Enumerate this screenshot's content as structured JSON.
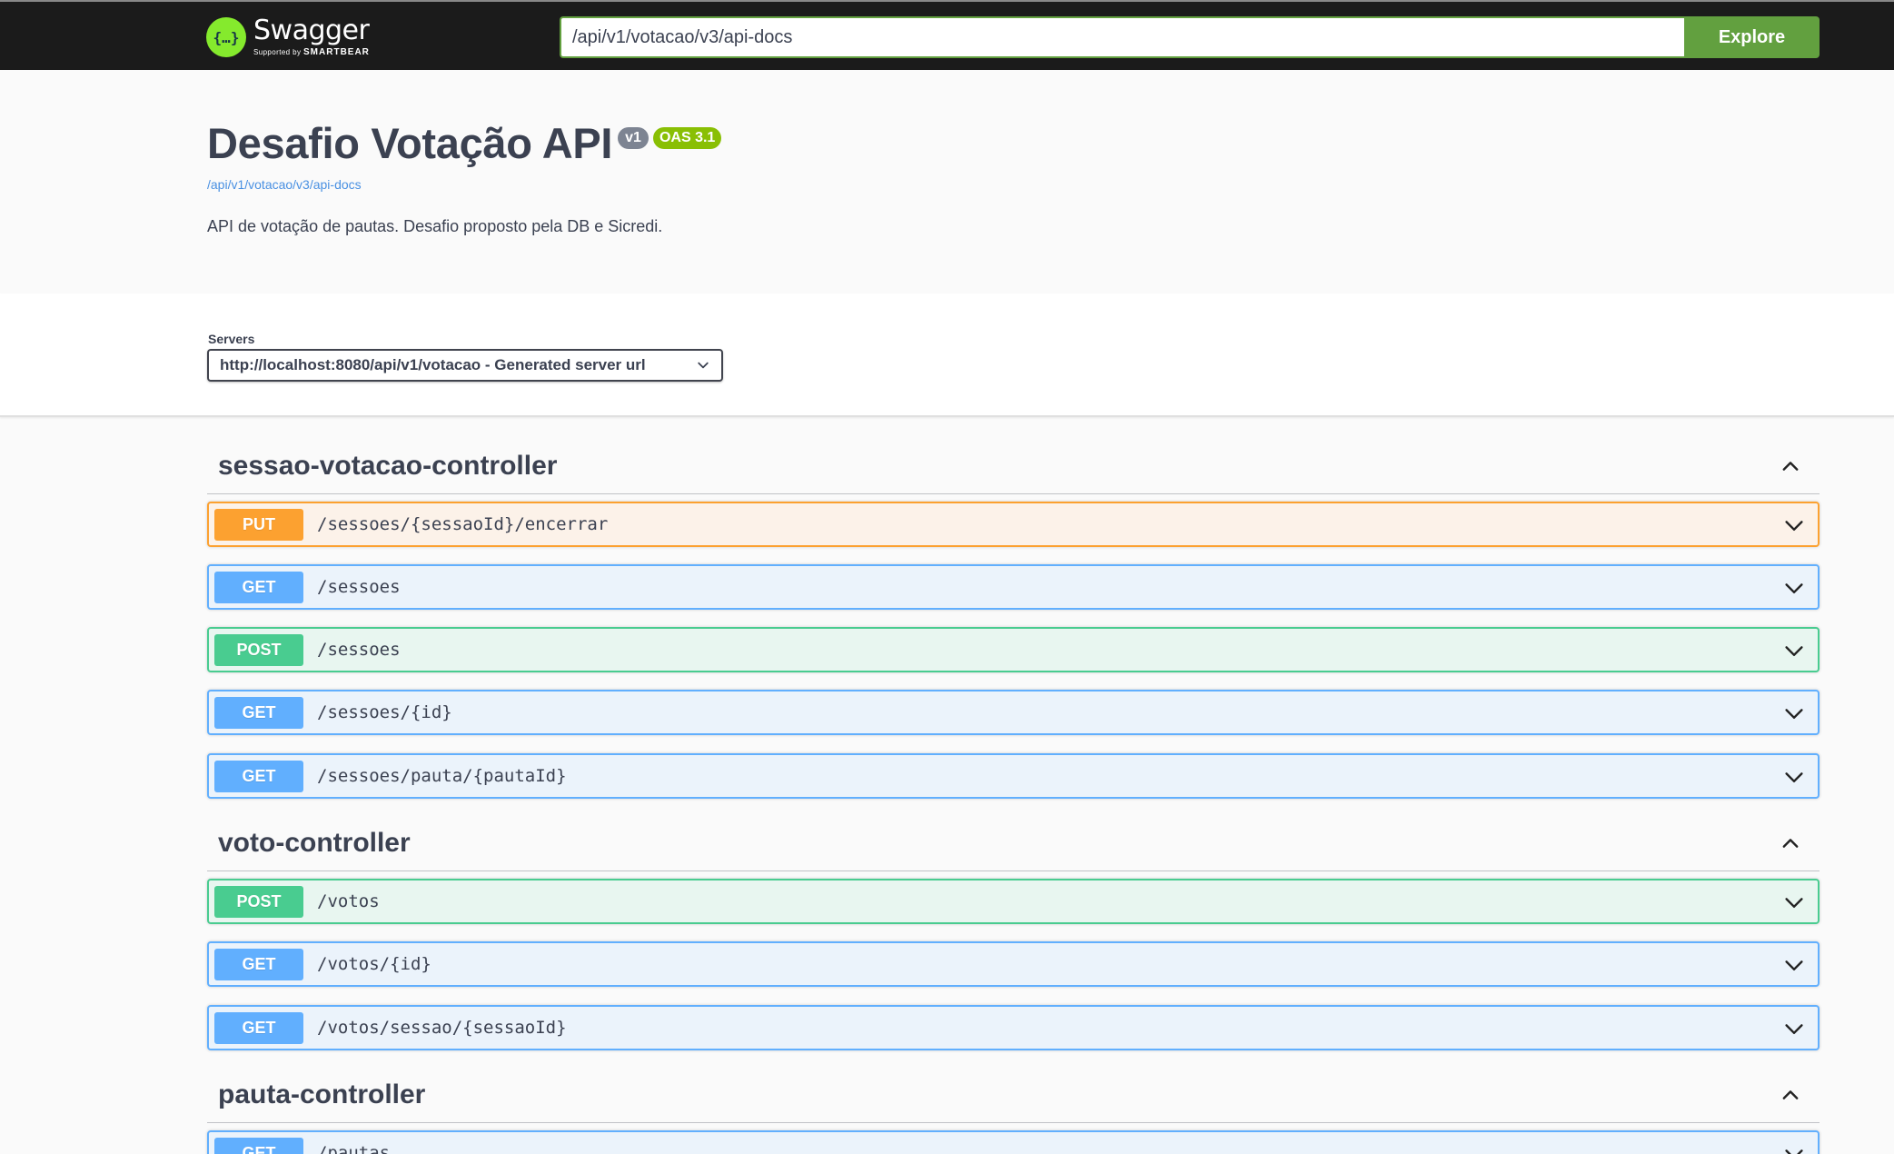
{
  "topbar": {
    "logo_name": "Swagger",
    "logo_sub_prefix": "Supported by",
    "logo_sub_brand": "SMARTBEAR",
    "url_value": "/api/v1/votacao/v3/api-docs",
    "explore_label": "Explore"
  },
  "info": {
    "title": "Desafio Votação API",
    "version_badge": "v1",
    "oas_badge": "OAS 3.1",
    "spec_link": "/api/v1/votacao/v3/api-docs",
    "description": "API de votação de pautas. Desafio proposto pela DB e Sicredi."
  },
  "servers": {
    "label": "Servers",
    "selected": "http://localhost:8080/api/v1/votacao - Generated server url"
  },
  "tags": [
    {
      "name": "sessao-votacao-controller",
      "operations": [
        {
          "method": "PUT",
          "path": "/sessoes/{sessaoId}/encerrar"
        },
        {
          "method": "GET",
          "path": "/sessoes"
        },
        {
          "method": "POST",
          "path": "/sessoes"
        },
        {
          "method": "GET",
          "path": "/sessoes/{id}"
        },
        {
          "method": "GET",
          "path": "/sessoes/pauta/{pautaId}"
        }
      ]
    },
    {
      "name": "voto-controller",
      "operations": [
        {
          "method": "POST",
          "path": "/votos"
        },
        {
          "method": "GET",
          "path": "/votos/{id}"
        },
        {
          "method": "GET",
          "path": "/votos/sessao/{sessaoId}"
        }
      ]
    },
    {
      "name": "pauta-controller",
      "operations": [
        {
          "method": "GET",
          "path": "/pautas"
        }
      ]
    }
  ],
  "colors": {
    "put": "#fca130",
    "get": "#61affe",
    "post": "#49cc90",
    "explore": "#62a03f",
    "oas_badge": "#89bf04"
  }
}
